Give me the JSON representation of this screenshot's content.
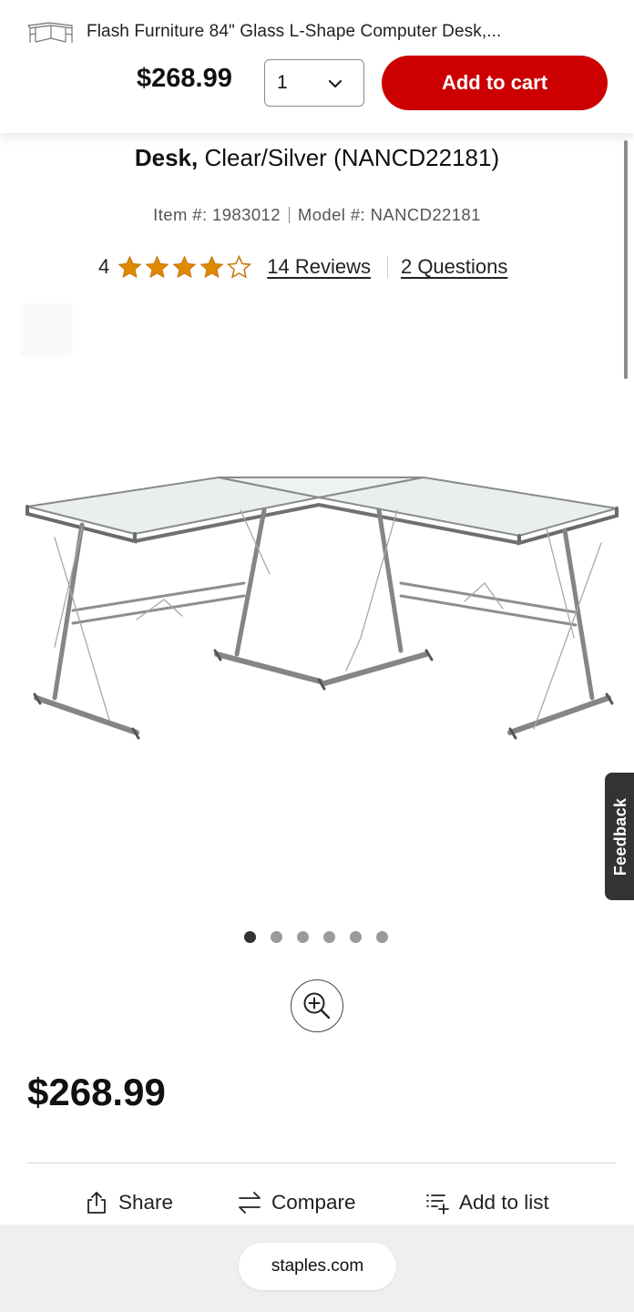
{
  "sticky_header": {
    "product_title": "Flash Furniture 84\" Glass L-Shape Computer Desk,...",
    "price": "$268.99",
    "quantity": "1",
    "add_to_cart_label": "Add to cart",
    "accent_color": "#cc0000"
  },
  "product": {
    "title_bold": "Desk,",
    "title_rest": " Clear/Silver (NANCD22181)",
    "item_number": "Item #: 1983012",
    "model_number": "Model #: NANCD22181",
    "rating": "4",
    "rating_value": 4,
    "rating_max": 5,
    "reviews_label": "14 Reviews",
    "questions_label": "2 Questions",
    "star_color": "#e08a00",
    "image_count": 6,
    "active_image": 1,
    "price": "$268.99"
  },
  "feedback_label": "Feedback",
  "actions": {
    "share": "Share",
    "compare": "Compare",
    "add_to_list": "Add to list"
  },
  "browser": {
    "url": "staples.com"
  },
  "icons": [
    "desk-thumbnail",
    "chevron-down-icon",
    "star-icon",
    "zoom-in-icon",
    "share-icon",
    "compare-icon",
    "add-to-list-icon"
  ]
}
